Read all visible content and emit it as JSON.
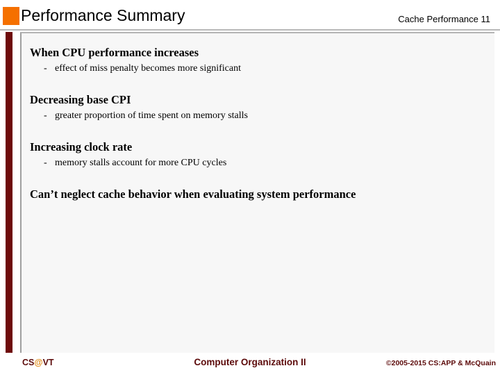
{
  "header": {
    "title": "Performance Summary",
    "subtitle": "Cache Performance 11",
    "accent_color": "#F57000"
  },
  "sidebar": {
    "bar_color": "#6E0B0B"
  },
  "content": {
    "groups": [
      {
        "heading": "When CPU performance increases",
        "marker": "-",
        "sub": "effect of miss penalty becomes more significant"
      },
      {
        "heading": "Decreasing base CPI",
        "marker": "-",
        "sub": "greater proportion of time spent on memory stalls"
      },
      {
        "heading": "Increasing clock rate",
        "marker": "-",
        "sub": "memory stalls account for more CPU cycles"
      }
    ],
    "closing": "Can’t neglect cache behavior when evaluating system performance"
  },
  "footer": {
    "brand_prefix": "CS",
    "brand_at": "@",
    "brand_suffix": "VT",
    "course": "Computer Organization II",
    "copyright": "©2005-2015 CS:APP & McQuain",
    "text_color": "#5C0A0A",
    "at_color": "#E08A16"
  }
}
